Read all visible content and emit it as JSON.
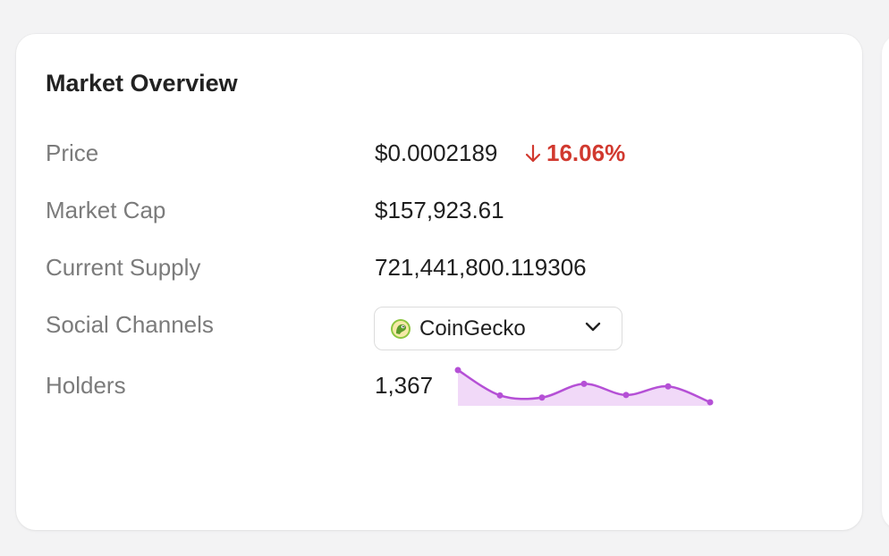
{
  "card": {
    "title": "Market Overview",
    "rows": {
      "price": {
        "label": "Price",
        "value": "$0.0002189",
        "change": "16.06%",
        "direction": "down"
      },
      "market_cap": {
        "label": "Market Cap",
        "value": "$157,923.61"
      },
      "current_supply": {
        "label": "Current Supply",
        "value": "721,441,800.119306"
      },
      "social_channels": {
        "label": "Social Channels",
        "selected": "CoinGecko",
        "icon": "coingecko-icon"
      },
      "holders": {
        "label": "Holders",
        "value": "1,367"
      }
    }
  },
  "holders_sparkline": {
    "type": "line",
    "values": [
      8.5,
      2.6,
      2.1,
      5.3,
      2.7,
      4.7,
      1.0
    ],
    "color": "#b550d6",
    "fill": "#f1d9f8"
  },
  "colors": {
    "negative": "#d1392f",
    "label": "#7b7b7b",
    "text": "#1f1f1f"
  }
}
